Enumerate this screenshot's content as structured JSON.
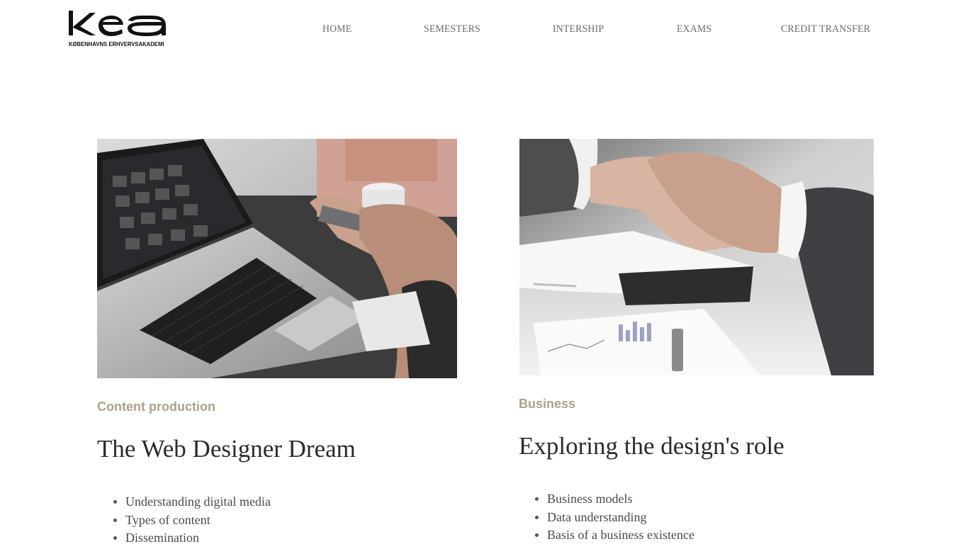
{
  "header": {
    "logo": {
      "mark": "kea",
      "subtitle": "KØBENHAVNS ERHVERVSAKADEMI"
    },
    "nav": [
      {
        "label": "HOME"
      },
      {
        "label": "SEMESTERS"
      },
      {
        "label": "INTERSHIP"
      },
      {
        "label": "EXAMS"
      },
      {
        "label": "CREDIT TRANSFER"
      }
    ]
  },
  "cards": [
    {
      "category": "Content production",
      "title": "The Web Designer Dream",
      "items": [
        "Understanding digital media",
        "Types of content",
        "Dissemination"
      ]
    },
    {
      "category": "Business",
      "title": "Exploring the design's role",
      "items": [
        "Business models",
        "Data understanding",
        "Basis of a business existence"
      ]
    }
  ],
  "colors": {
    "category": "#aaa28a",
    "title": "#2b2b2b",
    "nav": "#6b6b6b",
    "logo": "#111111"
  }
}
